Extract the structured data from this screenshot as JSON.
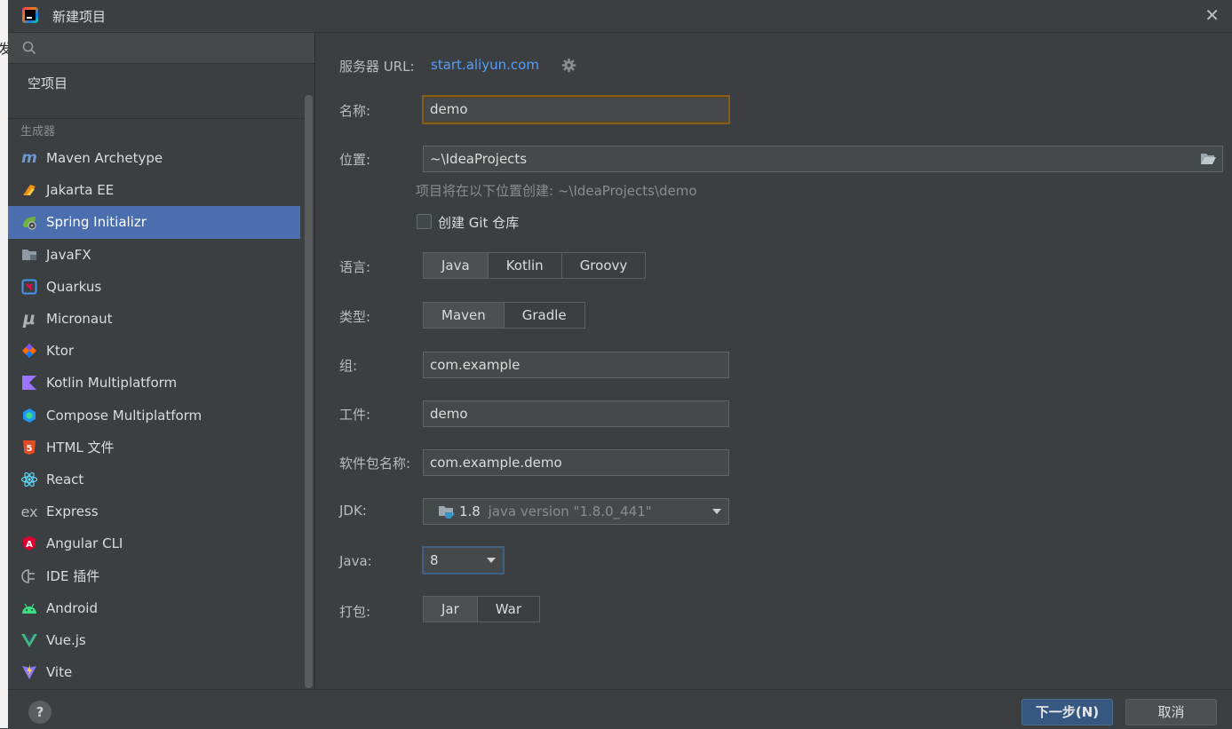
{
  "window": {
    "title": "新建项目"
  },
  "background": {
    "fragment": "发"
  },
  "sidebar": {
    "empty_project": "空项目",
    "group_label": "生成器",
    "items": [
      {
        "label": "Maven Archetype",
        "icon": "maven-icon"
      },
      {
        "label": "Jakarta EE",
        "icon": "jakarta-icon"
      },
      {
        "label": "Spring Initializr",
        "icon": "spring-icon",
        "selected": true
      },
      {
        "label": "JavaFX",
        "icon": "javafx-icon"
      },
      {
        "label": "Quarkus",
        "icon": "quarkus-icon"
      },
      {
        "label": "Micronaut",
        "icon": "micronaut-icon"
      },
      {
        "label": "Ktor",
        "icon": "ktor-icon"
      },
      {
        "label": "Kotlin Multiplatform",
        "icon": "kotlin-icon"
      },
      {
        "label": "Compose Multiplatform",
        "icon": "compose-icon"
      },
      {
        "label": "HTML 文件",
        "icon": "html5-icon"
      },
      {
        "label": "React",
        "icon": "react-icon"
      },
      {
        "label": "Express",
        "icon": "express-icon"
      },
      {
        "label": "Angular CLI",
        "icon": "angular-icon"
      },
      {
        "label": "IDE 插件",
        "icon": "plugin-icon"
      },
      {
        "label": "Android",
        "icon": "android-icon"
      },
      {
        "label": "Vue.js",
        "icon": "vue-icon"
      },
      {
        "label": "Vite",
        "icon": "vite-icon"
      }
    ]
  },
  "form": {
    "server_url_label": "服务器 URL:",
    "server_url": "start.aliyun.com",
    "name_label": "名称:",
    "name_value": "demo",
    "location_label": "位置:",
    "location_value": "~\\IdeaProjects",
    "location_hint": "项目将在以下位置创建: ~\\IdeaProjects\\demo",
    "git_label": "创建 Git 仓库",
    "git_checked": false,
    "language_label": "语言:",
    "languages": [
      "Java",
      "Kotlin",
      "Groovy"
    ],
    "language_selected": "Java",
    "type_label": "类型:",
    "types": [
      "Maven",
      "Gradle"
    ],
    "type_selected": "Maven",
    "group_label": "组:",
    "group_value": "com.example",
    "artifact_label": "工件:",
    "artifact_value": "demo",
    "package_label": "软件包名称:",
    "package_value": "com.example.demo",
    "jdk_label": "JDK:",
    "jdk_version": "1.8",
    "jdk_detail": "java version \"1.8.0_441\"",
    "java_label": "Java:",
    "java_value": "8",
    "packaging_label": "打包:",
    "packagings": [
      "Jar",
      "War"
    ],
    "packaging_selected": "Jar"
  },
  "footer": {
    "help": "?",
    "next": "下一步(N)",
    "cancel": "取消"
  },
  "colors": {
    "accent": "#4b6eaf",
    "link": "#589df6",
    "primary_button": "#365880"
  }
}
